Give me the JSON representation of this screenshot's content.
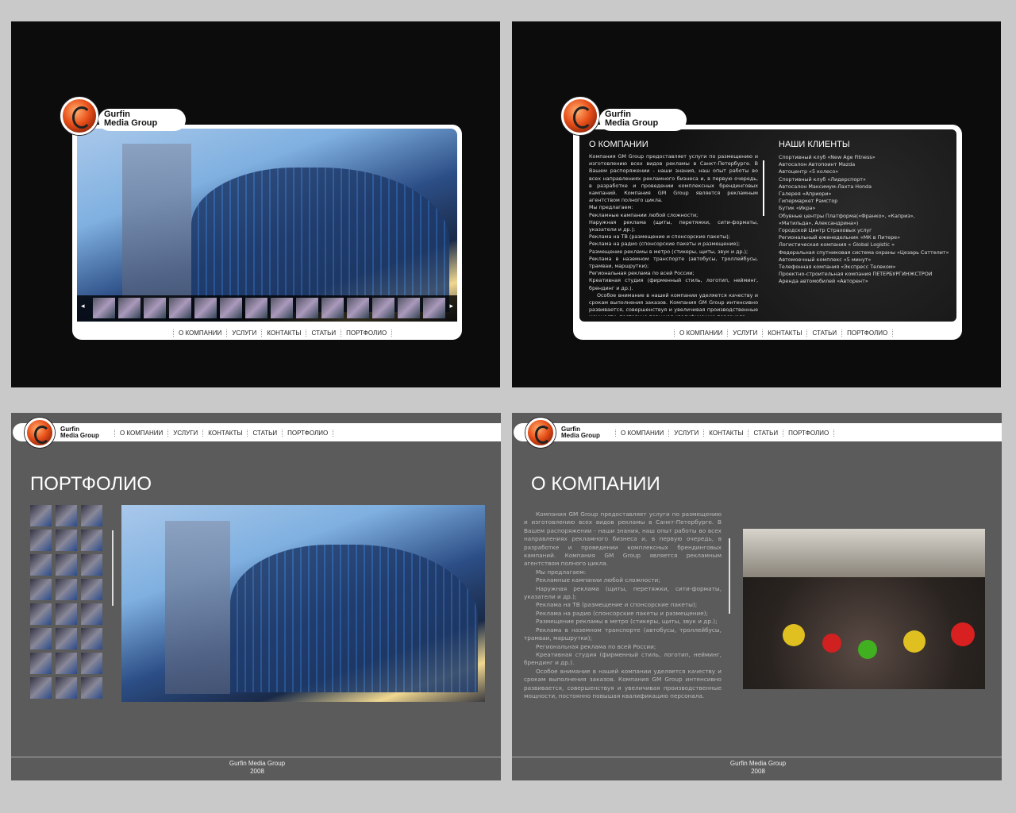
{
  "brand": {
    "line1": "Gurfin",
    "line2": "Media Group",
    "footer_name": "Gurfin Media Group",
    "footer_year": "2008"
  },
  "nav": [
    "О КОМПАНИИ",
    "УСЛУГИ",
    "КОНТАКТЫ",
    "СТАТЬИ",
    "ПОРТФОЛИО"
  ],
  "about": {
    "title": "О КОМПАНИИ",
    "paragraphs": [
      "Компания GM Group предоставляет услуги по размещению и изготовлению всех видов рекламы в Санкт-Петербурге. В Вашем распоряжении - наши знания, наш опыт работы во всех направлениях рекламного бизнеса и, в первую очередь, в разработке и проведении комплексных брендинговых кампаний. Компания GM Group является рекламным агентством полного цикла.",
      "Мы предлагаем:",
      "Рекламные кампании любой сложности;",
      "Наружная реклама (щиты, перетяжки, сити-форматы, указатели и др.);",
      "Реклама на ТВ (размещение и спонсорские пакеты);",
      "Реклама на радио (спонсорские пакеты и размещение);",
      "Размещение рекламы в метро (стикеры, щиты, звук и др.);",
      "Реклама в наземном транспорте (автобусы, троллейбусы, трамваи, маршрутки);",
      "Региональная реклама по всей России;",
      "Креативная студия (фирменный стиль, логотип, нейминг, брендинг и др.).",
      "Особое внимание в нашей компании уделяется качеству и срокам выполнения заказов. Компания GM Group интенсивно развивается, совершенствуя и увеличивая производственные мощности, постоянно повышая квалификацию персонала."
    ]
  },
  "clients": {
    "title": "НАШИ КЛИЕНТЫ",
    "items": [
      "Спортивный клуб «New Age Fitness»",
      "Автосалон Автопоинт Mazda",
      "Автоцентр «5 колесо»",
      "Спортивный клуб «Лидерспорт»",
      "Автосалон Максимум-Лахта Honda",
      "Галерея «Априори»",
      "Гипермаркет Рамстор",
      "Бутик «Икра»",
      "Обувные центры Платформа(«Франко», «Каприз», «Матильда», Александрина»)",
      "Городской Центр Страховых услуг",
      "Региональный еженедельник «МК в Питере»",
      "Логистическая компания « Global Logistic »",
      "Федеральная спутниковая система охраны «Цезарь Саттелит»",
      "Автомоечный комплекс «5 минут»",
      "Телефонная компания «Экспресс Телеком»",
      "Проектно-строительная компания ПЕТЕРБУРГИНЖСТРОИ",
      "Аренда автомобилей «Авторент»"
    ]
  },
  "portfolio": {
    "title": "ПОРТФОЛИО"
  },
  "arrows": {
    "prev": "◂",
    "next": "▸"
  }
}
